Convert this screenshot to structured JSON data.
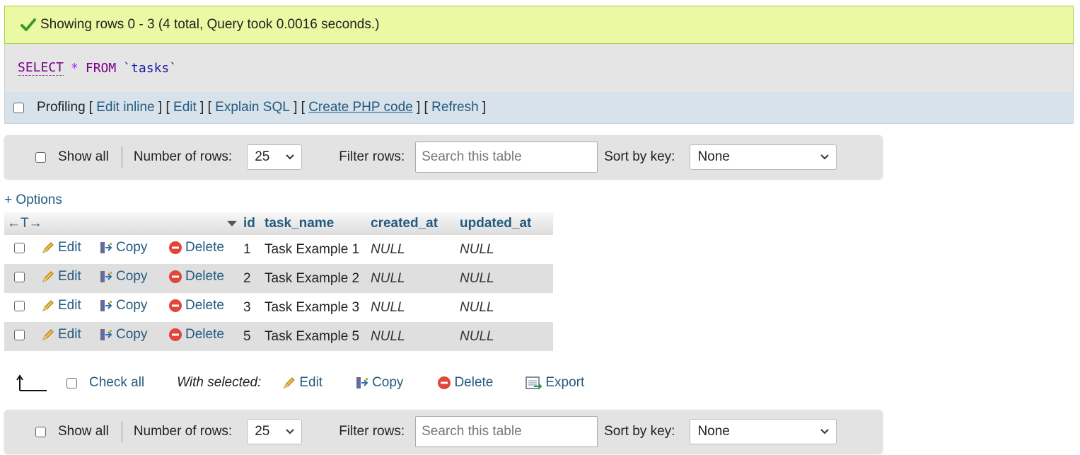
{
  "success_message": "Showing rows 0 - 3 (4 total, Query took 0.0016 seconds.)",
  "sql": {
    "select": "SELECT",
    "star": "*",
    "from": "FROM",
    "table": "`tasks`"
  },
  "profiling": {
    "label": "Profiling",
    "links": [
      "Edit inline",
      "Edit",
      "Explain SQL",
      "Create PHP code",
      "Refresh"
    ]
  },
  "nav": {
    "show_all": "Show all",
    "num_rows_label": "Number of rows:",
    "num_rows_value": "25",
    "filter_label": "Filter rows:",
    "filter_placeholder": "Search this table",
    "sort_label": "Sort by key:",
    "sort_value": "None"
  },
  "options_link": "+ Options",
  "table": {
    "arrows": "←T→",
    "columns": [
      "id",
      "task_name",
      "created_at",
      "updated_at"
    ],
    "row_actions": {
      "edit": "Edit",
      "copy": "Copy",
      "delete": "Delete"
    },
    "rows": [
      {
        "id": "1",
        "task_name": "Task Example 1",
        "created_at": "NULL",
        "updated_at": "NULL"
      },
      {
        "id": "2",
        "task_name": "Task Example 2",
        "created_at": "NULL",
        "updated_at": "NULL"
      },
      {
        "id": "3",
        "task_name": "Task Example 3",
        "created_at": "NULL",
        "updated_at": "NULL"
      },
      {
        "id": "5",
        "task_name": "Task Example 5",
        "created_at": "NULL",
        "updated_at": "NULL"
      }
    ]
  },
  "bulk": {
    "check_all": "Check all",
    "with_selected": "With selected:",
    "edit": "Edit",
    "copy": "Copy",
    "delete": "Delete",
    "export": "Export"
  },
  "colors": {
    "link": "#235a81",
    "success_bg": "#ebf8a4",
    "success_border": "#a2d246"
  }
}
